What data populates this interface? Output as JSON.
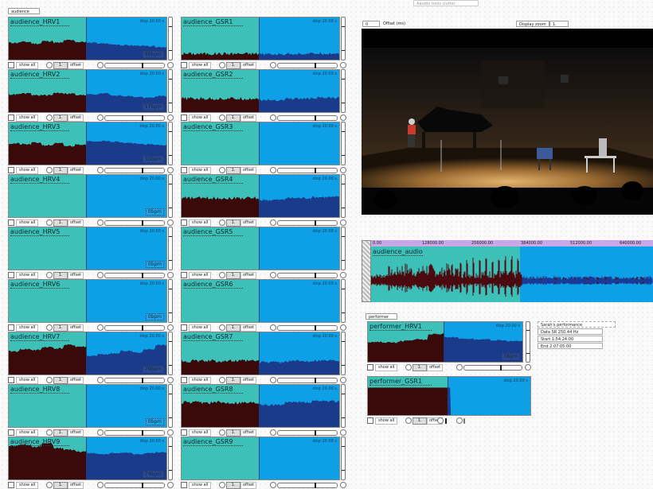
{
  "top_label": "Aaudio tools clutter",
  "audience_label": "audience",
  "performer_label": "performer",
  "disp_text": "disp 20.00 s",
  "show_all_label": "show all",
  "offset_label": "offset",
  "offset_value": "1.",
  "audience_hrv": [
    {
      "name": "audience_HRV1",
      "bpm": "66bpm"
    },
    {
      "name": "audience_HRV2",
      "bpm": "57bpm"
    },
    {
      "name": "audience_HRV3",
      "bpm": "55bpm"
    },
    {
      "name": "audience_HRV4",
      "bpm": "0bpm"
    },
    {
      "name": "audience_HRV5",
      "bpm": "0bpm"
    },
    {
      "name": "audience_HRV6",
      "bpm": "0bpm"
    },
    {
      "name": "audience_HRV7",
      "bpm": "79bpm"
    },
    {
      "name": "audience_HRV8",
      "bpm": "0bpm"
    },
    {
      "name": "audience_HRV9",
      "bpm": "74bpm"
    }
  ],
  "audience_gsr": [
    {
      "name": "audience_GSR1"
    },
    {
      "name": "audience_GSR2"
    },
    {
      "name": "audience_GSR3"
    },
    {
      "name": "audience_GSR4"
    },
    {
      "name": "audience_GSR5"
    },
    {
      "name": "audience_GSR6"
    },
    {
      "name": "audience_GSR7"
    },
    {
      "name": "audience_GSR8"
    },
    {
      "name": "audience_GSR9"
    }
  ],
  "video": {
    "offset_value": "0",
    "offset_label": "Offset (ms)",
    "zoom_label": "Display zoom x",
    "zoom_value": "1."
  },
  "audio": {
    "title": "audience_audio",
    "ruler": [
      "0.00",
      "128000.00",
      "256000.00",
      "384000.00",
      "512000.00",
      "640000.00"
    ]
  },
  "performer": {
    "hrv": {
      "name": "performer_HRV1",
      "bpm": "0bpm"
    },
    "gsr": {
      "name": "performer_GSR1"
    }
  },
  "info": {
    "title": "Sarah's performance",
    "sr": "Data SR 250.44 Hz",
    "start": "Start 1:54:24:00",
    "end": "End 2:07:05:00"
  },
  "colors": {
    "teal": "#3dc0b8",
    "blue": "#0da0e6",
    "navy": "#1a3a8a",
    "dark": "#3a0a0a",
    "ruler": "#c8a8e8"
  }
}
